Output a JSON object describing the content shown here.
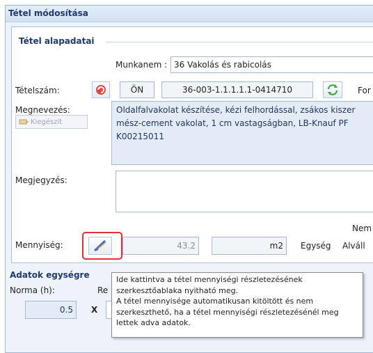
{
  "window": {
    "title": "Tétel módosítása"
  },
  "basic": {
    "legend": "Tétel alapadatai",
    "munkanem_label": "Munkanem :",
    "munkanem_value": "36 Vakolás és rabicolás",
    "tetelszam_label": "Tételszám:",
    "source_code": "ÖN",
    "item_number": "36-003-1.1.1.1.1-0414710",
    "cut_label": "For",
    "megnevezes_label": "Megnevezés:",
    "kiegeszit_label": "Kiegészít",
    "description_lines": [
      "Oldalfalvakolat készítése, kézi felhordással, zsákos kiszer",
      "mész-cement vakolat, 1 cm vastagságban, LB-Knauf PF",
      "K00215011"
    ],
    "megjegyzes_label": "Megjegyzés:",
    "megjegyzes_value": "",
    "nem_label": "Nem",
    "mennyiseg_label": "Mennyiség:",
    "quantity": "43.2",
    "unit": "m2",
    "egyseg_label": "Egység",
    "alvall_label": "Alváll"
  },
  "unit_data": {
    "legend": "Adatok egységre",
    "norma_label": "Norma (h):",
    "re_label": "Re",
    "norma_value": "0.5",
    "x_label": "X"
  },
  "tooltip": {
    "lines": [
      "Ide kattintva a tétel mennyiségi részletezésének",
      "szerkesztőablaka nyitható meg.",
      "A tétel mennyisége automatikusan kitöltött és nem",
      "szerkeszthető, ha a tétel mennyiségi részletezésénél meg",
      "lettek adva adatok."
    ]
  }
}
